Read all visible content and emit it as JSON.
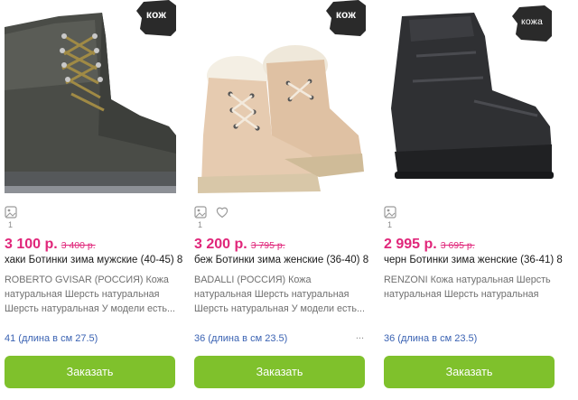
{
  "products": [
    {
      "badge": "кож",
      "image_alt": "Ботинки мужские хаки",
      "photo_count": "1",
      "price": "3 100 р.",
      "old_price": "3 400 р.",
      "title": "хаки Ботинки зима мужские (40-45) 8",
      "description": "ROBERTO GVISAR (РОССИЯ) Кожа натуральная Шерсть натуральная Шерсть натуральная У модели есть...",
      "size": "41 (длина в см 27.5)",
      "more": "",
      "order_label": "Заказать",
      "has_favorite": false
    },
    {
      "badge": "кож",
      "image_alt": "Ботинки женские беж",
      "photo_count": "1",
      "price": "3 200 р.",
      "old_price": "3 795 р.",
      "title": "беж Ботинки зима женские (36-40) 8",
      "description": "BADALLI (РОССИЯ) Кожа натуральная Шерсть натуральная Шерсть натуральная У модели есть...",
      "size": "36 (длина в см 23.5)",
      "more": "...",
      "order_label": "Заказать",
      "has_favorite": true
    },
    {
      "badge": "кожа",
      "image_alt": "Ботинки женские черн",
      "photo_count": "1",
      "price": "2 995 р.",
      "old_price": "3 695 р.",
      "title": "черн Ботинки зима женские (36-41) 8",
      "description": "RENZONI Кожа натуральная Шерсть натуральная Шерсть натуральная",
      "size": "36 (длина в см 23.5)",
      "more": "",
      "order_label": "Заказать",
      "has_favorite": false
    }
  ],
  "colors": {
    "price": "#e0267a",
    "button": "#7fc12c",
    "size_link": "#3b63b3",
    "badge": "#2a2a2a"
  },
  "icons": {
    "photo": "image-icon",
    "favorite": "heart-icon",
    "badge": "leather-hide-icon"
  }
}
